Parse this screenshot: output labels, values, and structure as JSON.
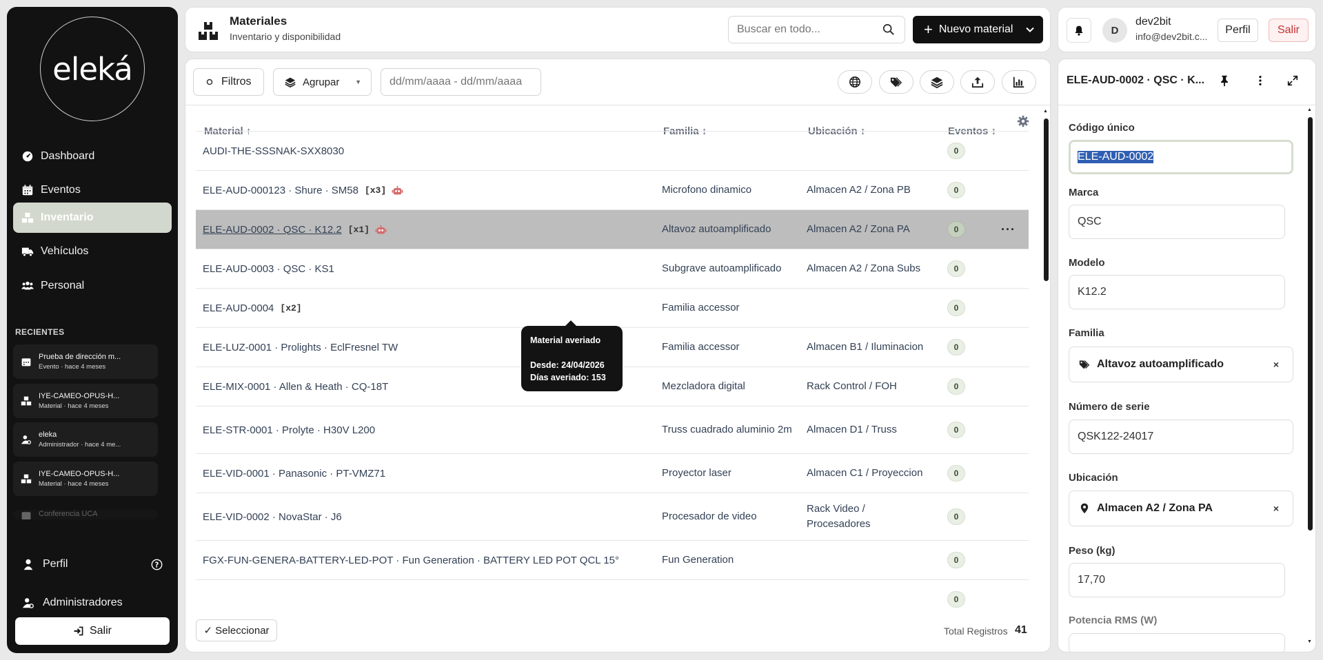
{
  "sidebar": {
    "logo": "eleká",
    "nav": [
      {
        "label": "Dashboard",
        "icon": "dashboard-icon"
      },
      {
        "label": "Eventos",
        "icon": "calendar-icon"
      },
      {
        "label": "Inventario",
        "icon": "boxes-icon",
        "active": true
      },
      {
        "label": "Vehículos",
        "icon": "truck-icon"
      },
      {
        "label": "Personal",
        "icon": "people-icon"
      }
    ],
    "recent_title": "RECIENTES",
    "recent": [
      {
        "title": "Prueba de dirección m...",
        "meta": "Evento · hace 4 meses",
        "icon": "calendar-icon"
      },
      {
        "title": "IYE-CAMEO-OPUS-H...",
        "meta": "Material · hace 4 meses",
        "icon": "boxes-icon"
      },
      {
        "title": "eleka",
        "meta": "Administrador · hace 4 me...",
        "icon": "user-gear-icon"
      },
      {
        "title": "IYE-CAMEO-OPUS-H...",
        "meta": "Material · hace 4 meses",
        "icon": "boxes-icon"
      },
      {
        "title": "Conferencia UCA",
        "meta": "",
        "icon": "calendar-icon"
      }
    ],
    "profile_label": "Perfil",
    "admins_label": "Administradores",
    "logout_label": "Salir"
  },
  "header": {
    "title": "Materiales",
    "subtitle": "Inventario y disponibilidad",
    "search_placeholder": "Buscar en todo...",
    "new_button": "Nuevo material"
  },
  "user": {
    "initial": "D",
    "name": "dev2bit",
    "email": "info@dev2bit.c...",
    "profile_button": "Perfil",
    "logout_button": "Salir"
  },
  "toolbar": {
    "filters": "Filtros",
    "group": "Agrupar",
    "date_placeholder": "dd/mm/aaaa - dd/mm/aaaa"
  },
  "table": {
    "columns": {
      "material": "Material ↑",
      "family": "Familia ↕",
      "location": "Ubicación ↕",
      "events": "Eventos ↕"
    },
    "rows": [
      {
        "material": "AUDI-THE-SSSNAK-SXX8030",
        "qty": "",
        "broken": false,
        "family": "",
        "location": "",
        "events": "0"
      },
      {
        "material": "ELE-AUD-000123 · Shure · SM58",
        "qty": "[x3]",
        "broken": true,
        "family": "Microfono dinamico",
        "location": "Almacen A2 / Zona PB",
        "events": "0"
      },
      {
        "material": "ELE-AUD-0002 · QSC · K12.2",
        "qty": "[x1]",
        "broken": true,
        "family": "Altavoz autoamplificado",
        "location": "Almacen A2 / Zona PA",
        "events": "0",
        "selected": true
      },
      {
        "material": "ELE-AUD-0003 · QSC · KS1",
        "qty": "",
        "broken": false,
        "family": "Subgrave autoamplificado",
        "location": "Almacen A2 / Zona Subs",
        "events": "0"
      },
      {
        "material": "ELE-AUD-0004",
        "qty": "[x2]",
        "broken": false,
        "family": "Familia accessor",
        "location": "",
        "events": "0"
      },
      {
        "material": "ELE-LUZ-0001 · Prolights · EclFresnel TW",
        "qty": "",
        "broken": false,
        "family": "Familia accessor",
        "location": "Almacen B1 / Iluminacion",
        "events": "0"
      },
      {
        "material": "ELE-MIX-0001 · Allen & Heath · CQ-18T",
        "qty": "",
        "broken": false,
        "family": "Mezcladora digital",
        "location": "Rack Control / FOH",
        "events": "0"
      },
      {
        "material": "ELE-STR-0001 · Prolyte · H30V L200",
        "qty": "",
        "broken": false,
        "family": "Truss cuadrado aluminio 2m",
        "location": "Almacen D1 / Truss",
        "events": "0"
      },
      {
        "material": "ELE-VID-0001 · Panasonic · PT-VMZ71",
        "qty": "",
        "broken": false,
        "family": "Proyector laser",
        "location": "Almacen C1 / Proyeccion",
        "events": "0"
      },
      {
        "material": "ELE-VID-0002 · NovaStar · J6",
        "qty": "",
        "broken": false,
        "family": "Procesador de video",
        "location": "Rack Video / Procesadores",
        "events": "0"
      },
      {
        "material": "FGX-FUN-GENERA-BATTERY-LED-POT · Fun Generation · BATTERY LED POT QCL 15°",
        "qty": "",
        "broken": false,
        "family": "Fun Generation",
        "location": "",
        "events": "0"
      },
      {
        "material": "",
        "qty": "",
        "broken": false,
        "family": "",
        "location": "",
        "events": "0"
      }
    ],
    "row_menu": "···"
  },
  "tooltip": {
    "title": "Material averiado",
    "since": "Desde: 24/04/2026",
    "days": "Días averiado: 153"
  },
  "footer": {
    "select_button": "✓ Seleccionar",
    "total_label": "Total Registros",
    "total_value": "41"
  },
  "detail": {
    "title": "ELE-AUD-0002 · QSC · K...",
    "fields": {
      "code_label": "Código único",
      "code_value": "ELE-AUD-0002",
      "brand_label": "Marca",
      "brand_value": "QSC",
      "model_label": "Modelo",
      "model_value": "K12.2",
      "family_label": "Familia",
      "family_value": "Altavoz autoamplificado",
      "serial_label": "Número de serie",
      "serial_value": "QSK122-24017",
      "location_label": "Ubicación",
      "location_value": "Almacen A2 / Zona PA",
      "weight_label": "Peso (kg)",
      "weight_value": "17,70",
      "power_label": "Potencia RMS (W)"
    },
    "remove_glyph": "×"
  },
  "colors": {
    "accent_active": "#d2d8cd",
    "sidebar_bg": "#121212",
    "danger": "#c23333",
    "robot": "#d46b6b"
  }
}
